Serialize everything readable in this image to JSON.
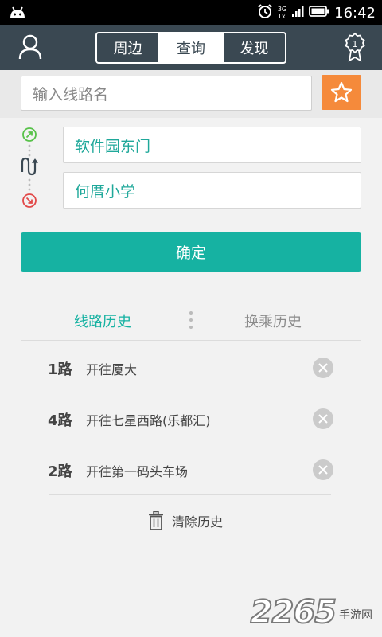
{
  "status": {
    "time": "16:42",
    "net_top": "3G",
    "net_bottom": "1x"
  },
  "tabs": [
    {
      "label": "周边"
    },
    {
      "label": "查询",
      "active": true
    },
    {
      "label": "发现"
    }
  ],
  "medal_count": "1",
  "search": {
    "placeholder": "输入线路名"
  },
  "route": {
    "from": "软件园东门",
    "to": "何厝小学"
  },
  "confirm_label": "确定",
  "history_tabs": {
    "line": "线路历史",
    "transfer": "换乘历史"
  },
  "history": [
    {
      "route": "1路",
      "dest": "开往厦大"
    },
    {
      "route": "4路",
      "dest": "开往七星西路(乐都汇)"
    },
    {
      "route": "2路",
      "dest": "开往第一码头车场"
    }
  ],
  "clear_label": "清除历史",
  "watermark": {
    "brand": "2265",
    "site": "手游网"
  },
  "colors": {
    "topbar": "#3a4852",
    "accent": "#16b2a2",
    "favorite": "#f58a3b"
  }
}
